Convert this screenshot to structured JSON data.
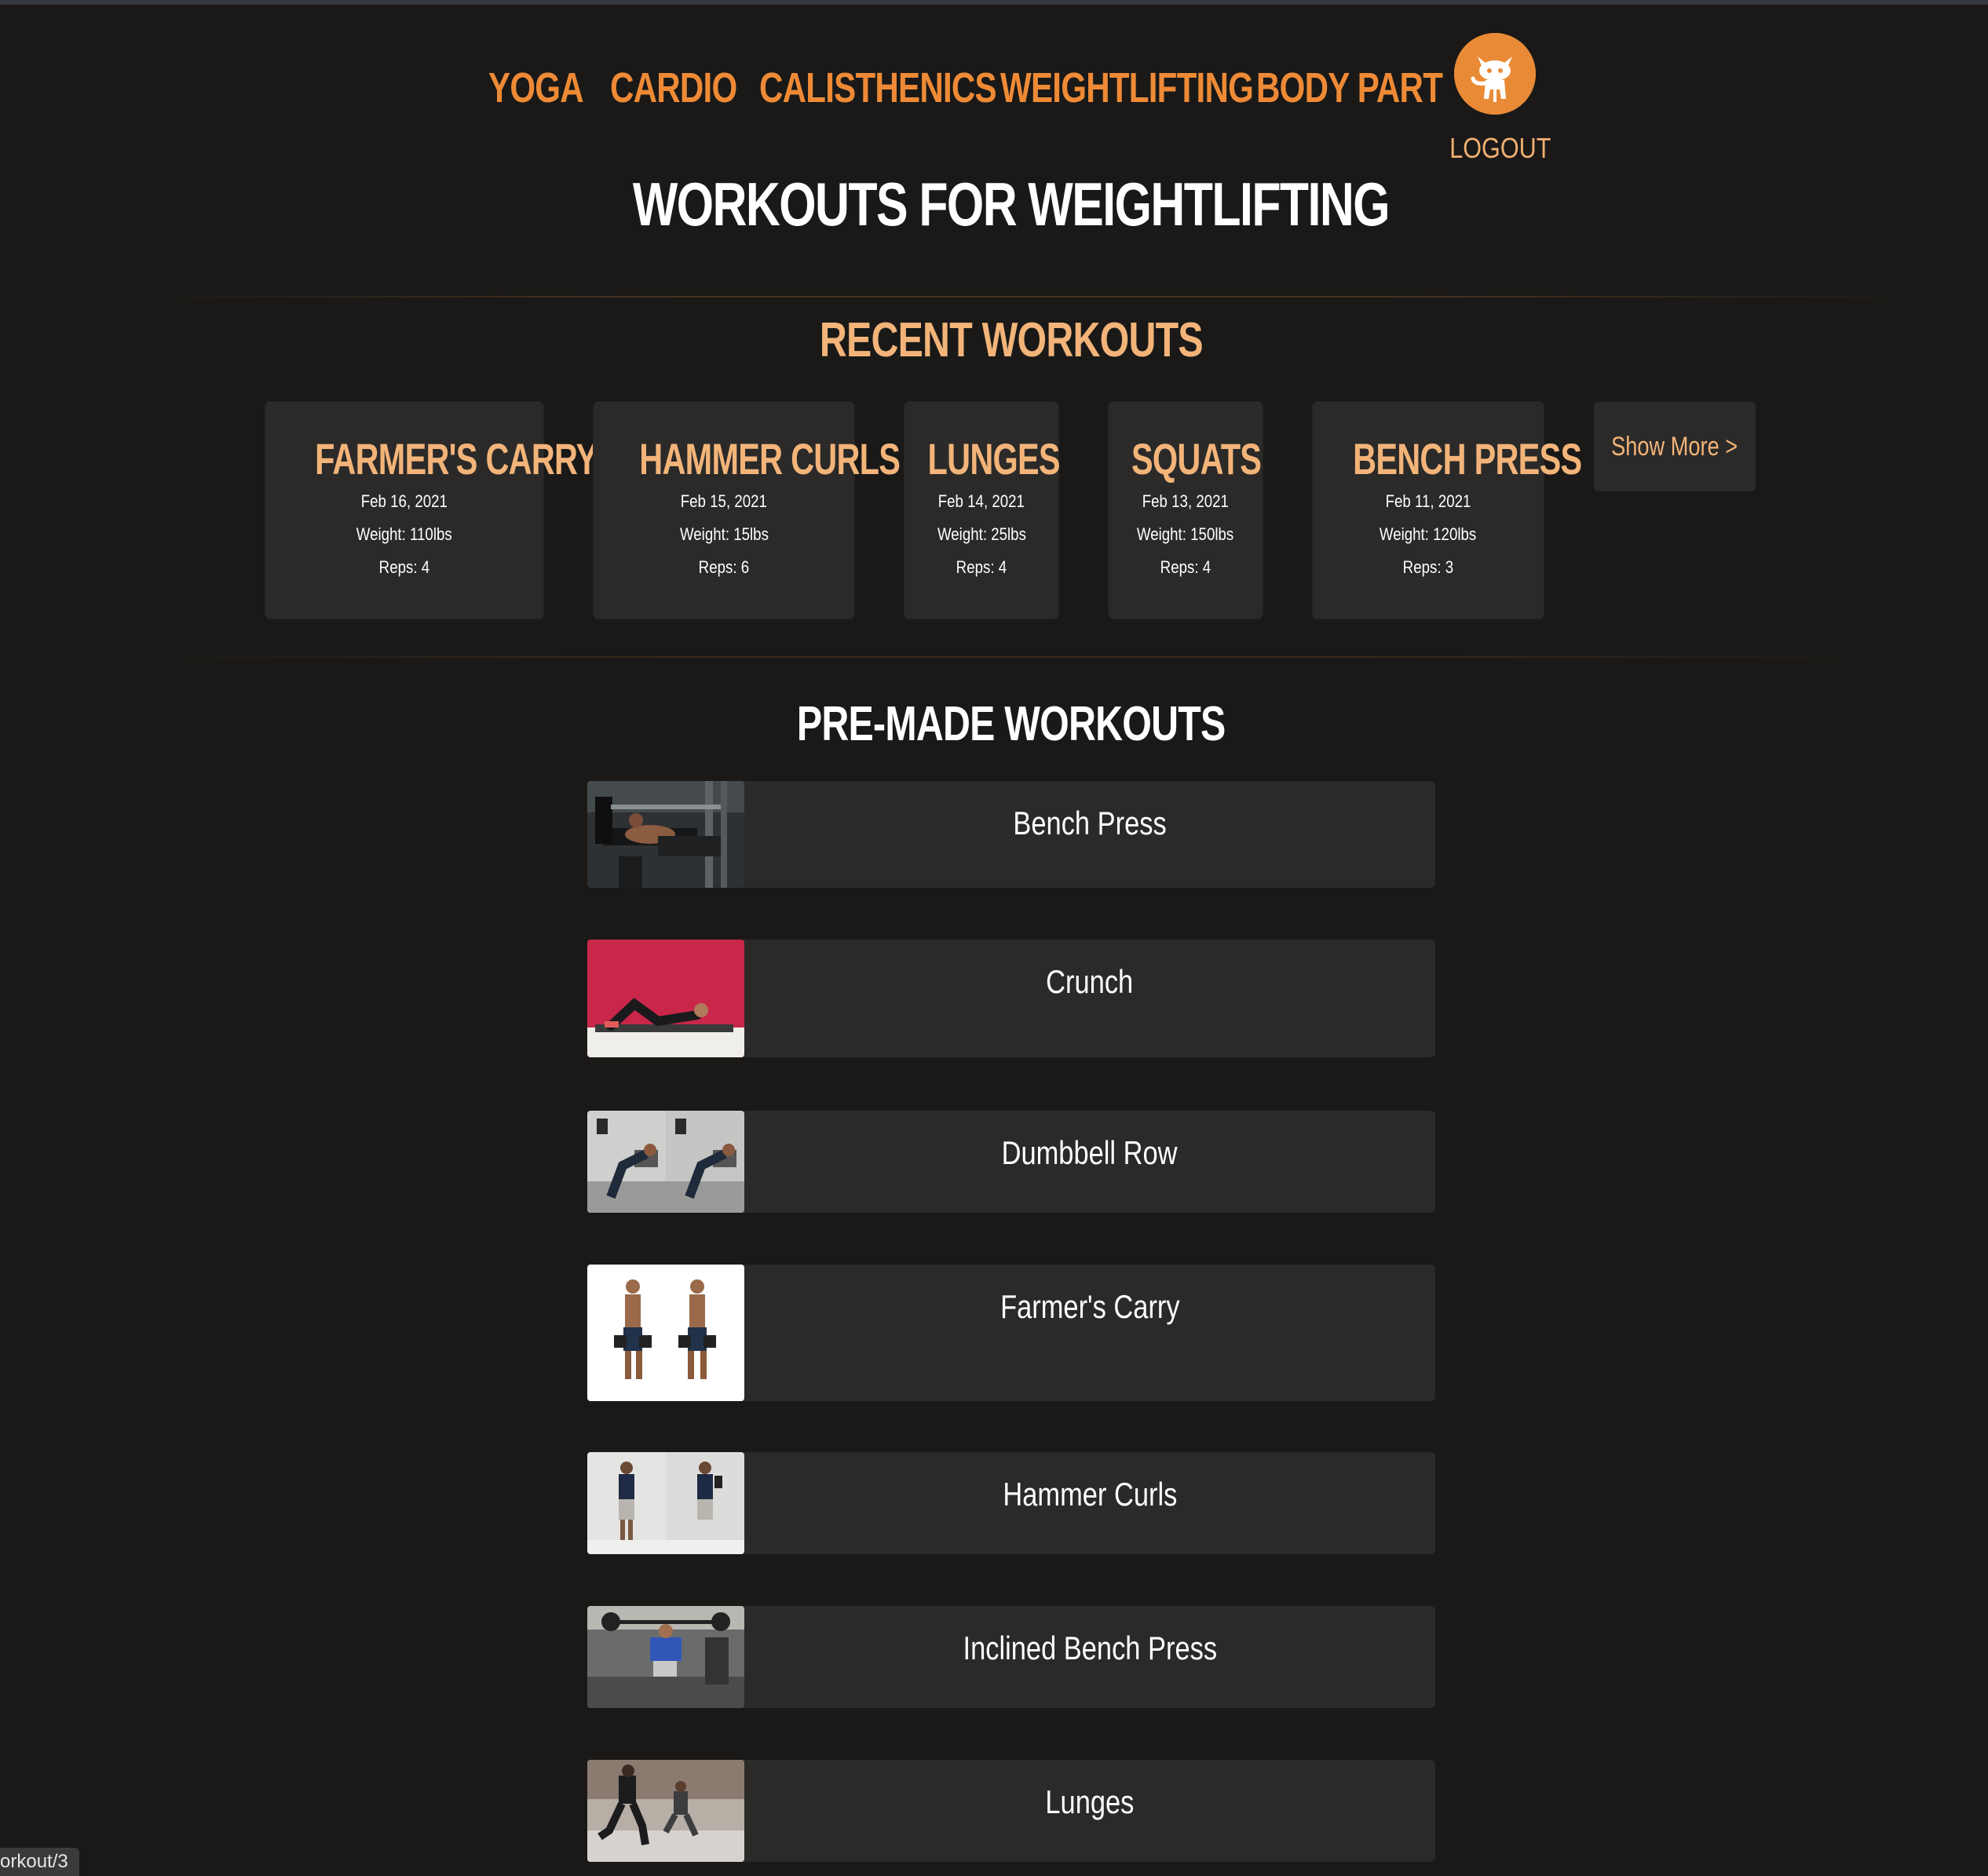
{
  "nav": {
    "items": [
      "YOGA",
      "CARDIO",
      "CALISTHENICS",
      "WEIGHTLIFTING",
      "BODY PART"
    ],
    "logout": "LOGOUT",
    "avatar_icon": "github-octocat-icon"
  },
  "page": {
    "title": "WORKOUTS FOR WEIGHTLIFTING"
  },
  "recent": {
    "title": "RECENT WORKOUTS",
    "cards": [
      {
        "name": "FARMER'S CARRY",
        "date": "Feb 16, 2021",
        "weight": "Weight: 110lbs",
        "reps": "Reps: 4"
      },
      {
        "name": "HAMMER CURLS",
        "date": "Feb 15, 2021",
        "weight": "Weight: 15lbs",
        "reps": "Reps: 6"
      },
      {
        "name": "LUNGES",
        "date": "Feb 14, 2021",
        "weight": "Weight: 25lbs",
        "reps": "Reps: 4"
      },
      {
        "name": "SQUATS",
        "date": "Feb 13, 2021",
        "weight": "Weight: 150lbs",
        "reps": "Reps: 4"
      },
      {
        "name": "BENCH PRESS",
        "date": "Feb 11, 2021",
        "weight": "Weight: 120lbs",
        "reps": "Reps: 3"
      }
    ],
    "show_more": "Show More >"
  },
  "premade": {
    "title": "PRE-MADE WORKOUTS",
    "items": [
      {
        "label": "Bench Press"
      },
      {
        "label": "Crunch"
      },
      {
        "label": "Dumbbell Row"
      },
      {
        "label": "Farmer's Carry"
      },
      {
        "label": "Hammer Curls"
      },
      {
        "label": "Inclined Bench Press"
      },
      {
        "label": "Lunges"
      }
    ]
  },
  "status_bar": {
    "url": "orkout/3"
  },
  "colors": {
    "accent": "#ee8a36",
    "accent_light": "#f3b479",
    "background": "#1a1918",
    "card": "#2b2a29"
  }
}
